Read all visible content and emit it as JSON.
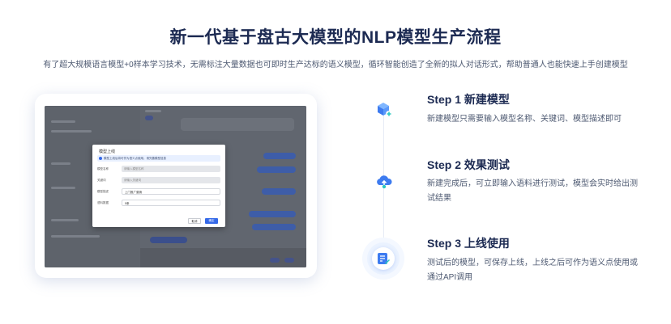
{
  "page": {
    "title": "新一代基于盘古大模型的NLP模型生产流程",
    "subtitle": "有了超大规模语言模型+0样本学习技术，无需标注大量数据也可即时生产达标的语义模型，循环智能创造了全新的拟人对话形式，帮助普通人也能快速上手创建模型"
  },
  "mockup": {
    "modal": {
      "title": "模型上线",
      "info": "模型上线后将可作为语义点使用，请完善模型信息",
      "fields": [
        {
          "label": "模型名称",
          "value": "",
          "placeholder": "请输入模型名称"
        },
        {
          "label": "关键词",
          "value": "",
          "placeholder": "请输入关键词"
        },
        {
          "label": "模型描述",
          "value": "上门推广营销",
          "placeholder": ""
        },
        {
          "label": "语料数据",
          "value": "5条",
          "placeholder": ""
        }
      ],
      "cancel_label": "取消",
      "ok_label": "确定"
    }
  },
  "steps": [
    {
      "title": "Step 1 新建模型",
      "desc": "新建模型只需要输入模型名称、关键词、模型描述即可",
      "icon": "cube-plus-icon"
    },
    {
      "title": "Step 2 效果测试",
      "desc": "新建完成后，可立即输入语料进行测试，模型会实时给出测试结果",
      "icon": "cloud-upload-icon"
    },
    {
      "title": "Step 3 上线使用",
      "desc": "测试后的模型，可保存上线，上线之后可作为语义点使用或通过API调用",
      "icon": "document-edit-icon"
    }
  ],
  "colors": {
    "accent": "#3569e8",
    "title": "#1c2a52",
    "text": "#4e5a72"
  }
}
